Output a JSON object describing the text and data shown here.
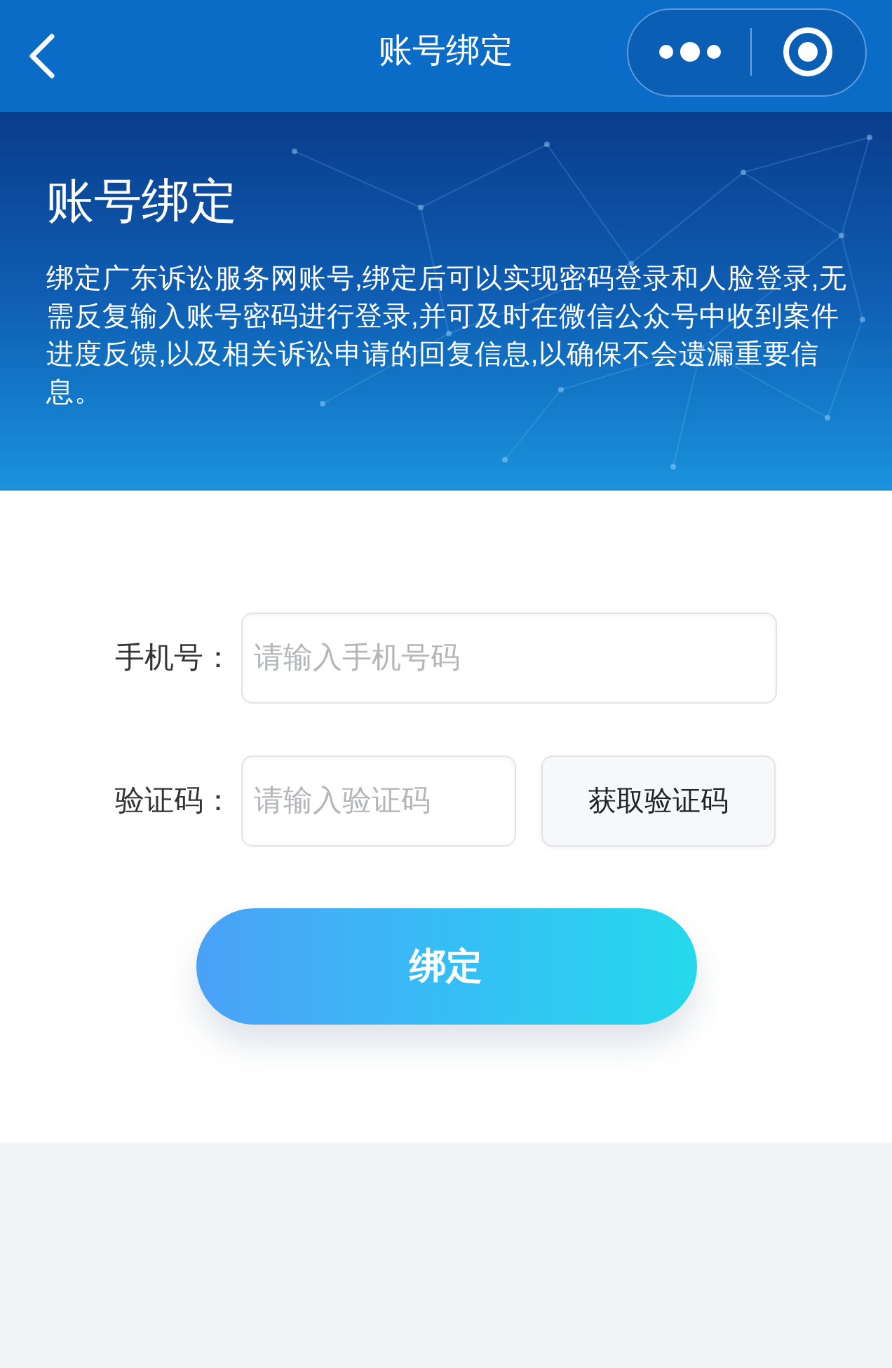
{
  "nav_bar": {
    "title": "账号绑定"
  },
  "banner": {
    "title": "账号绑定",
    "description": "绑定广东诉讼服务网账号,绑定后可以实现密码登录和人脸登录,无需反复输入账号密码进行登录,并可及时在微信公众号中收到案件进度反馈,以及相关诉讼申请的回复信息,以确保不会遗漏重要信息。"
  },
  "form": {
    "fields": [
      {
        "label": "手机号：",
        "placeholder": "请输入手机号码"
      },
      {
        "label": "验证码：",
        "placeholder": "请输入验证码",
        "button": "获取验证码"
      }
    ],
    "submit": "绑定"
  }
}
